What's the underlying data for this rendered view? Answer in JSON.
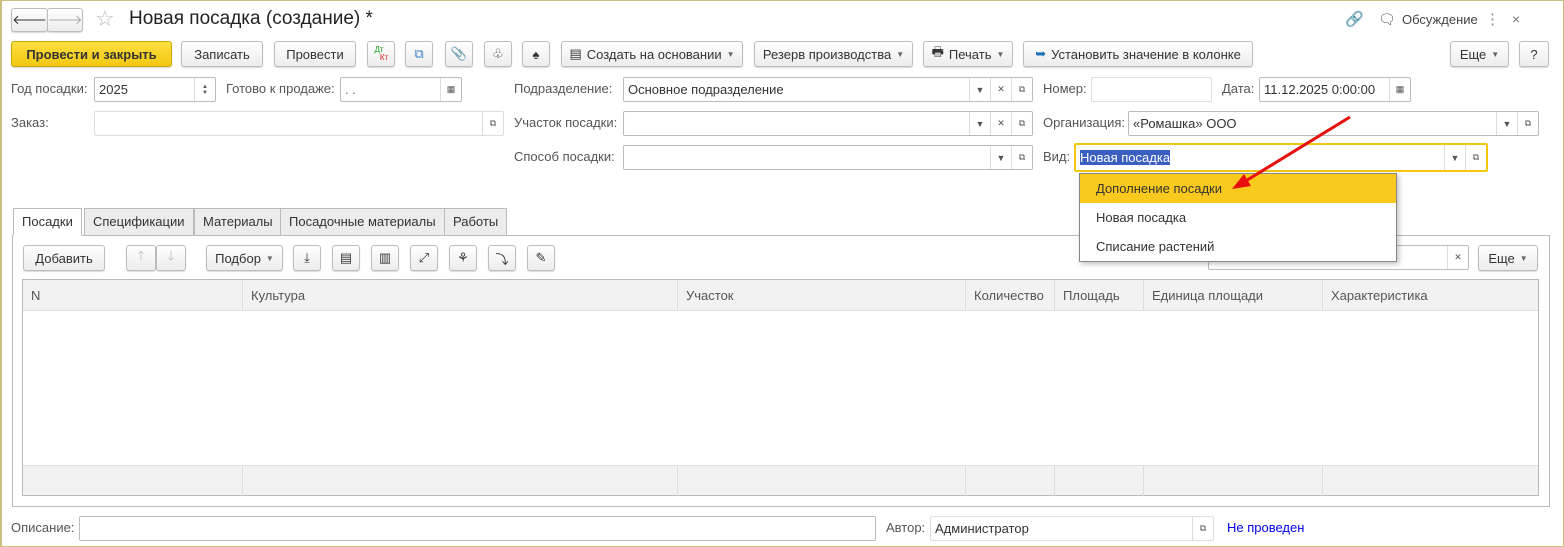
{
  "window": {
    "title": "Новая посадка (создание) *",
    "discussion": "Обсуждение"
  },
  "toolbar": {
    "post_close": "Провести и закрыть",
    "save": "Записать",
    "post": "Провести",
    "dtkt_dt": "Дт",
    "dtkt_kt": "Кт",
    "create_based": "Создать на основании",
    "reserve": "Резерв производства",
    "print": "Печать",
    "set_value": "Установить значение в колонке",
    "more": "Еще",
    "help": "?"
  },
  "form": {
    "year_label": "Год посадки:",
    "year_value": "2025",
    "ready_label": "Готово к продаже:",
    "ready_value": " .  .",
    "order_label": "Заказ:",
    "order_value": "",
    "division_label": "Подразделение:",
    "division_value": "Основное подразделение",
    "plot_label": "Участок посадки:",
    "plot_value": "",
    "method_label": "Способ посадки:",
    "method_value": "",
    "number_label": "Номер:",
    "number_value": "",
    "date_label": "Дата:",
    "date_value": "11.12.2025  0:00:00",
    "org_label": "Организация:",
    "org_value": "«Ромашка» ООО",
    "kind_label": "Вид:",
    "kind_value": "Новая посадка"
  },
  "dropdown": {
    "options": [
      "Дополнение посадки",
      "Новая посадка",
      "Списание растений"
    ],
    "highlighted": 0
  },
  "tabs": [
    "Посадки",
    "Спецификации",
    "Материалы",
    "Посадочные материалы",
    "Работы"
  ],
  "table_toolbar": {
    "add": "Добавить",
    "pick": "Подбор",
    "more": "Еще",
    "search_value": ""
  },
  "table": {
    "columns": [
      "N",
      "Культура",
      "Участок",
      "Количество",
      "Площадь",
      "Единица площади",
      "Характеристика"
    ],
    "rows": []
  },
  "footer": {
    "desc_label": "Описание:",
    "desc_value": "",
    "author_label": "Автор:",
    "author_value": "Администратор",
    "status": "Не проведен"
  },
  "colors": {
    "accent": "#f9ca1d",
    "status": "#0000ee",
    "arrow": "#e8100f",
    "selection": "#3b5fc0"
  }
}
